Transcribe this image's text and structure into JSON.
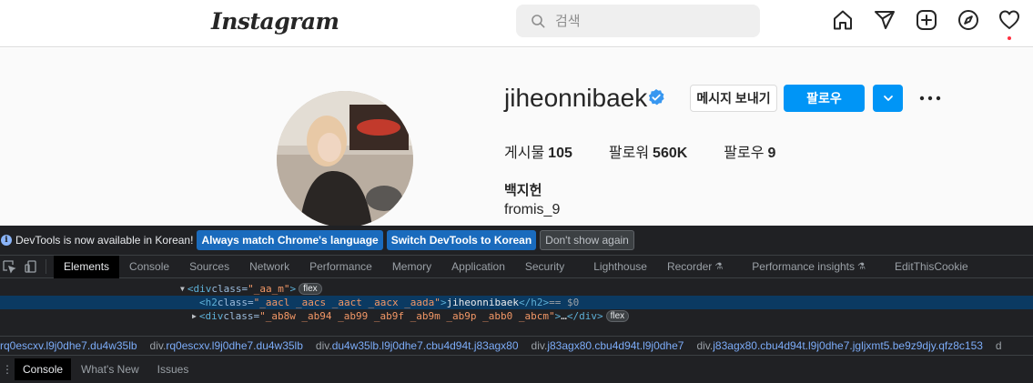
{
  "nav": {
    "logo": "Instagram",
    "search_placeholder": "검색",
    "icons": [
      "home-icon",
      "direct-send-icon",
      "new-post-icon",
      "explore-compass-icon",
      "activity-heart-icon"
    ]
  },
  "profile": {
    "username": "jiheonnibaek",
    "verified": true,
    "message_button": "메시지 보내기",
    "follow_button": "팔로우",
    "stats": [
      {
        "label": "게시물",
        "value": "105"
      },
      {
        "label": "팔로워",
        "value": "560K"
      },
      {
        "label": "팔로우",
        "value": "9"
      }
    ],
    "full_name": "백지헌",
    "bio": "fromis_9"
  },
  "devtools": {
    "infobar": {
      "text": "DevTools is now available in Korean!",
      "btn_match": "Always match Chrome's language",
      "btn_switch": "Switch DevTools to Korean",
      "btn_dismiss": "Don't show again"
    },
    "tabs": [
      "Elements",
      "Console",
      "Sources",
      "Network",
      "Performance",
      "Memory",
      "Application",
      "Security",
      "Lighthouse",
      "Recorder",
      "Performance insights",
      "EditThisCookie"
    ],
    "experimental_tabs": [
      "Recorder",
      "Performance insights"
    ],
    "dom": {
      "line1": {
        "tag_open": "<div",
        "attr": " class=",
        "val": "\"_aa_m\"",
        "close": ">",
        "badge": "flex"
      },
      "line2": {
        "tag_open": "<h2",
        "attr": " class=",
        "val": "\"_aacl _aacs _aact _aacx _aada\"",
        "close": ">",
        "text": "jiheonnibaek",
        "tag_end": "</h2>",
        "eq": " == $0"
      },
      "line3": {
        "tag_open": "<div",
        "attr": " class=",
        "val": "\"_ab8w  _ab94 _ab99 _ab9f _ab9m _ab9p  _abb0 _abcm\"",
        "close": ">",
        "ellipsis": "…",
        "tag_end": "</div>",
        "badge": "flex"
      }
    },
    "breadcrumbs": [
      {
        "prefix": "",
        "cls": "rq0escxv.l9j0dhe7.du4w35lb"
      },
      {
        "prefix": "div.",
        "cls": "rq0escxv.l9j0dhe7.du4w35lb"
      },
      {
        "prefix": "div.",
        "cls": "du4w35lb.l9j0dhe7.cbu4d94t.j83agx80"
      },
      {
        "prefix": "div.",
        "cls": "j83agx80.cbu4d94t.l9j0dhe7"
      },
      {
        "prefix": "div.",
        "cls": "j83agx80.cbu4d94t.l9j0dhe7.jgljxmt5.be9z9djy.qfz8c153"
      },
      {
        "prefix": "d",
        "cls": ""
      }
    ],
    "drawer_tabs": [
      "Console",
      "What's New",
      "Issues"
    ]
  }
}
